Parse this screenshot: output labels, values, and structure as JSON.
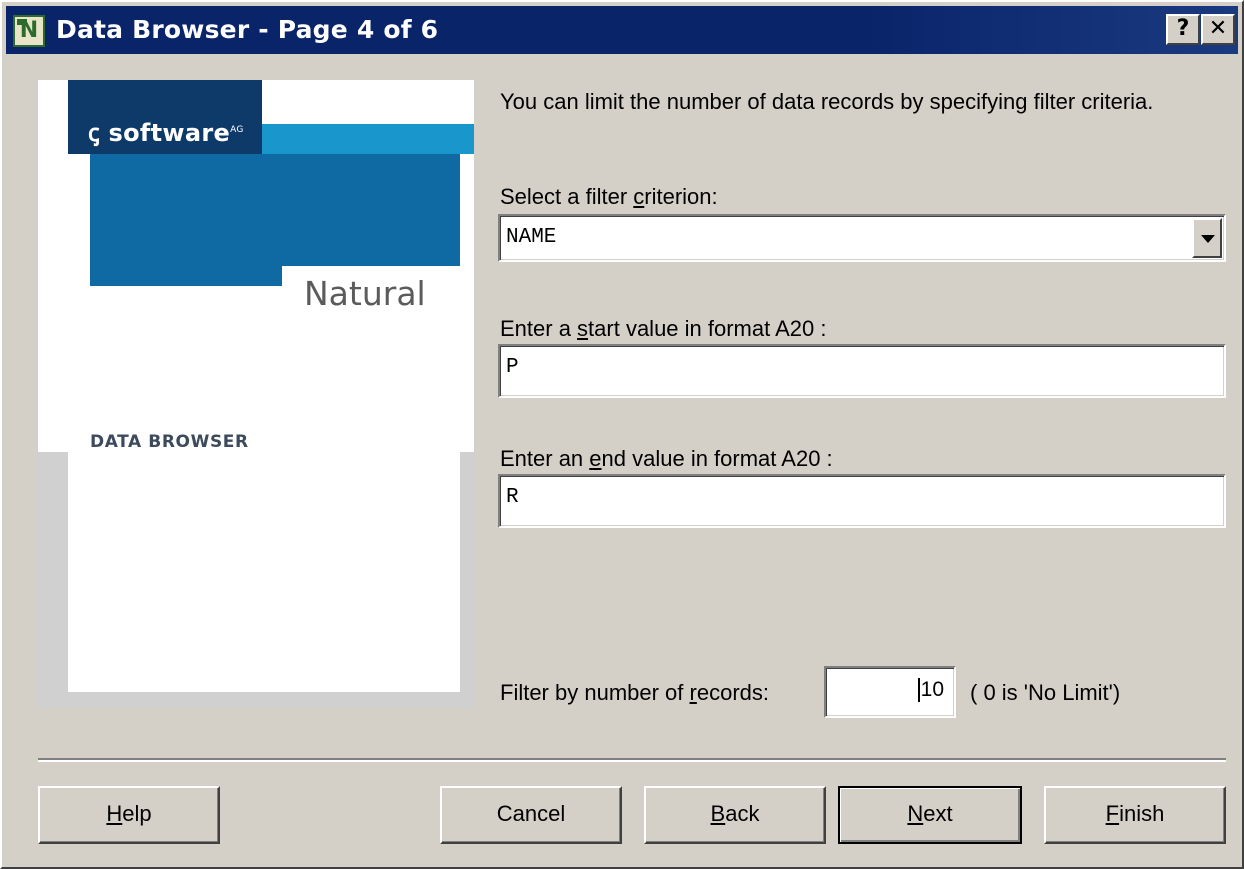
{
  "window": {
    "title": "Data Browser - Page 4 of 6",
    "app_icon_letter": "N",
    "help_button": "?",
    "close_button": "✕"
  },
  "banner": {
    "logo_text": "software",
    "logo_sup": "AG",
    "product": "Natural",
    "section": "DATA BROWSER",
    "colors": {
      "dark": "#0e3a6a",
      "cyan": "#1996cc",
      "mid": "#0f6aa3"
    }
  },
  "content": {
    "intro": "You can limit the number of data records by specifying filter criteria.",
    "filter_criterion": {
      "label_pre": "Select a filter ",
      "label_mn": "c",
      "label_post": "riterion:",
      "selected": "NAME"
    },
    "start_value": {
      "label_pre": "Enter a ",
      "label_mn": "s",
      "label_post": "tart value in format A20 :",
      "value": "P"
    },
    "end_value": {
      "label_pre": "Enter an ",
      "label_mn": "e",
      "label_post": "nd value in format A20 :",
      "value": "R"
    },
    "records": {
      "label_pre": "Filter by number of ",
      "label_mn": "r",
      "label_post": "ecords:",
      "value": "10",
      "hint": "( 0 is 'No Limit')"
    }
  },
  "buttons": {
    "help": {
      "mn": "H",
      "rest": "elp"
    },
    "cancel": "Cancel",
    "back": {
      "mn": "B",
      "rest": "ack"
    },
    "next": {
      "mn": "N",
      "rest": "ext"
    },
    "finish": {
      "mn": "F",
      "rest": "inish"
    }
  }
}
